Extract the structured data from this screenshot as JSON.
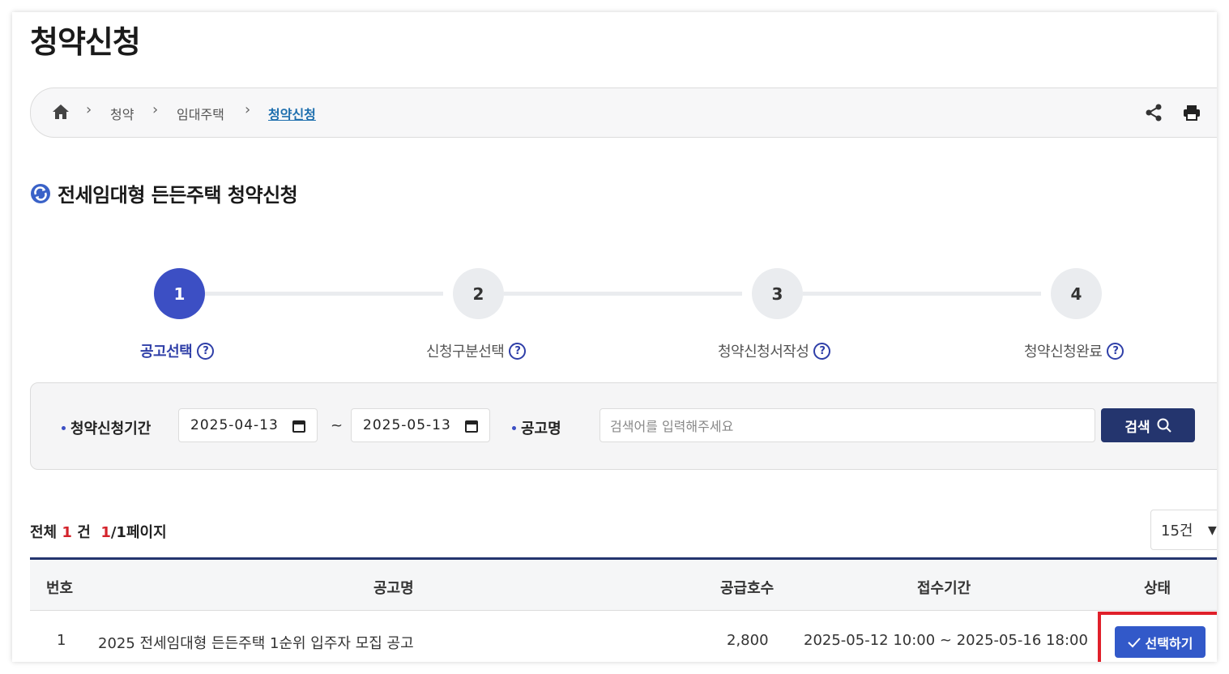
{
  "page": {
    "title": "청약신청"
  },
  "breadcrumb": {
    "items": [
      "청약",
      "임대주택"
    ],
    "current": "청약신청",
    "home_icon": "home-icon",
    "share_icon": "share-icon",
    "print_icon": "print-icon"
  },
  "section": {
    "title": "전세임대형 든든주택 청약신청",
    "icon": "refresh-icon"
  },
  "steps": [
    {
      "number": "1",
      "label": "공고선택",
      "active": true
    },
    {
      "number": "2",
      "label": "신청구분선택",
      "active": false
    },
    {
      "number": "3",
      "label": "청약신청서작성",
      "active": false
    },
    {
      "number": "4",
      "label": "청약신청완료",
      "active": false
    }
  ],
  "help_glyph": "?",
  "search": {
    "period_label": "청약신청기간",
    "start_date": "2025-04-13",
    "tilde": "~",
    "end_date": "2025-05-13",
    "name_label": "공고명",
    "placeholder": "검색어를 입력해주세요",
    "button_label": "검색"
  },
  "result": {
    "prefix": "전체",
    "total": "1",
    "unit": "건",
    "page_current": "1",
    "page_suffix": "/1페이지",
    "per_page": "15건"
  },
  "table": {
    "headers": [
      "번호",
      "공고명",
      "공급호수",
      "접수기간",
      "상태"
    ],
    "rows": [
      {
        "no": "1",
        "name": "2025 전세임대형 든든주택 1순위 입주자 모집 공고",
        "supply": "2,800",
        "period": "2025-05-12 10:00 ~ 2025-05-16 18:00",
        "status_button": "선택하기"
      }
    ]
  },
  "colors": {
    "accent": "#3c4fc4",
    "navy": "#24356e",
    "select_button": "#3259c9",
    "highlight": "#e0202a",
    "link": "#1e6fae"
  }
}
